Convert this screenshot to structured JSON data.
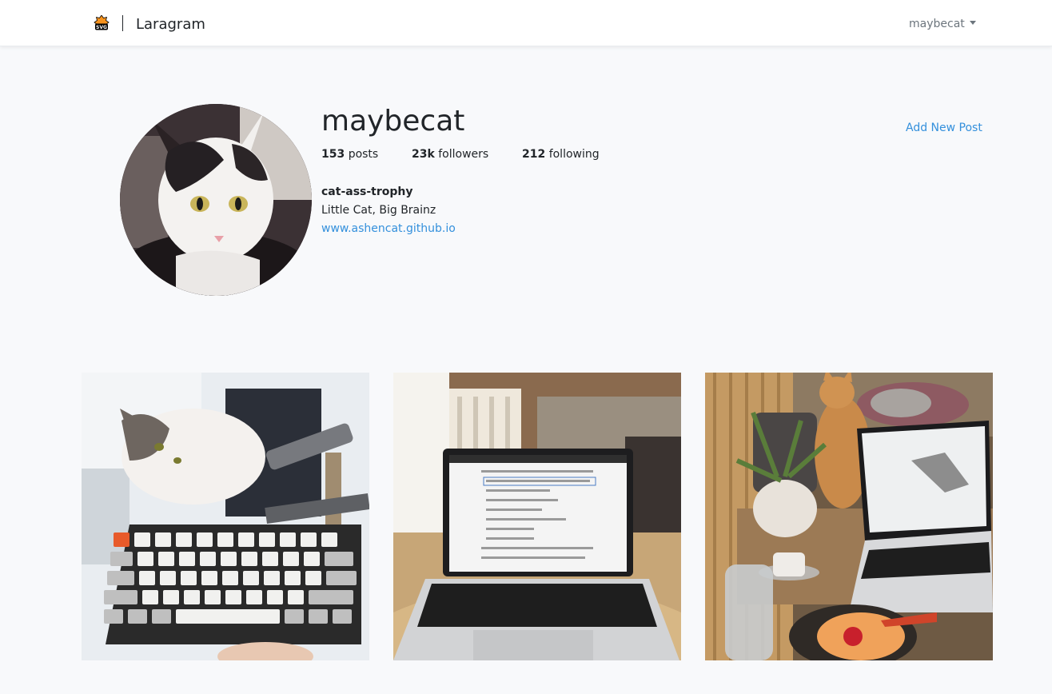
{
  "navbar": {
    "logo_text": "SVG",
    "brand": "Laragram",
    "user_menu_label": "maybecat"
  },
  "profile": {
    "username": "maybecat",
    "add_post_label": "Add New Post",
    "stats": {
      "posts_count": "153",
      "posts_label": "posts",
      "followers_count": "23k",
      "followers_label": "followers",
      "following_count": "212",
      "following_label": "following"
    },
    "bio": {
      "title": "cat-ass-trophy",
      "description": "Little Cat, Big Brainz",
      "url": "www.ashencat.github.io"
    }
  },
  "posts": [
    {
      "subject": "cat-on-cat-tree-with-keyboard"
    },
    {
      "subject": "laptop-in-cafe"
    },
    {
      "subject": "cat-with-laptop-and-coffee"
    }
  ],
  "colors": {
    "page_bg": "#f8f9fb",
    "navbar_bg": "#ffffff",
    "link": "#3490dc",
    "muted": "#6c757d",
    "text": "#212529",
    "logo_orange": "#f7931e"
  }
}
